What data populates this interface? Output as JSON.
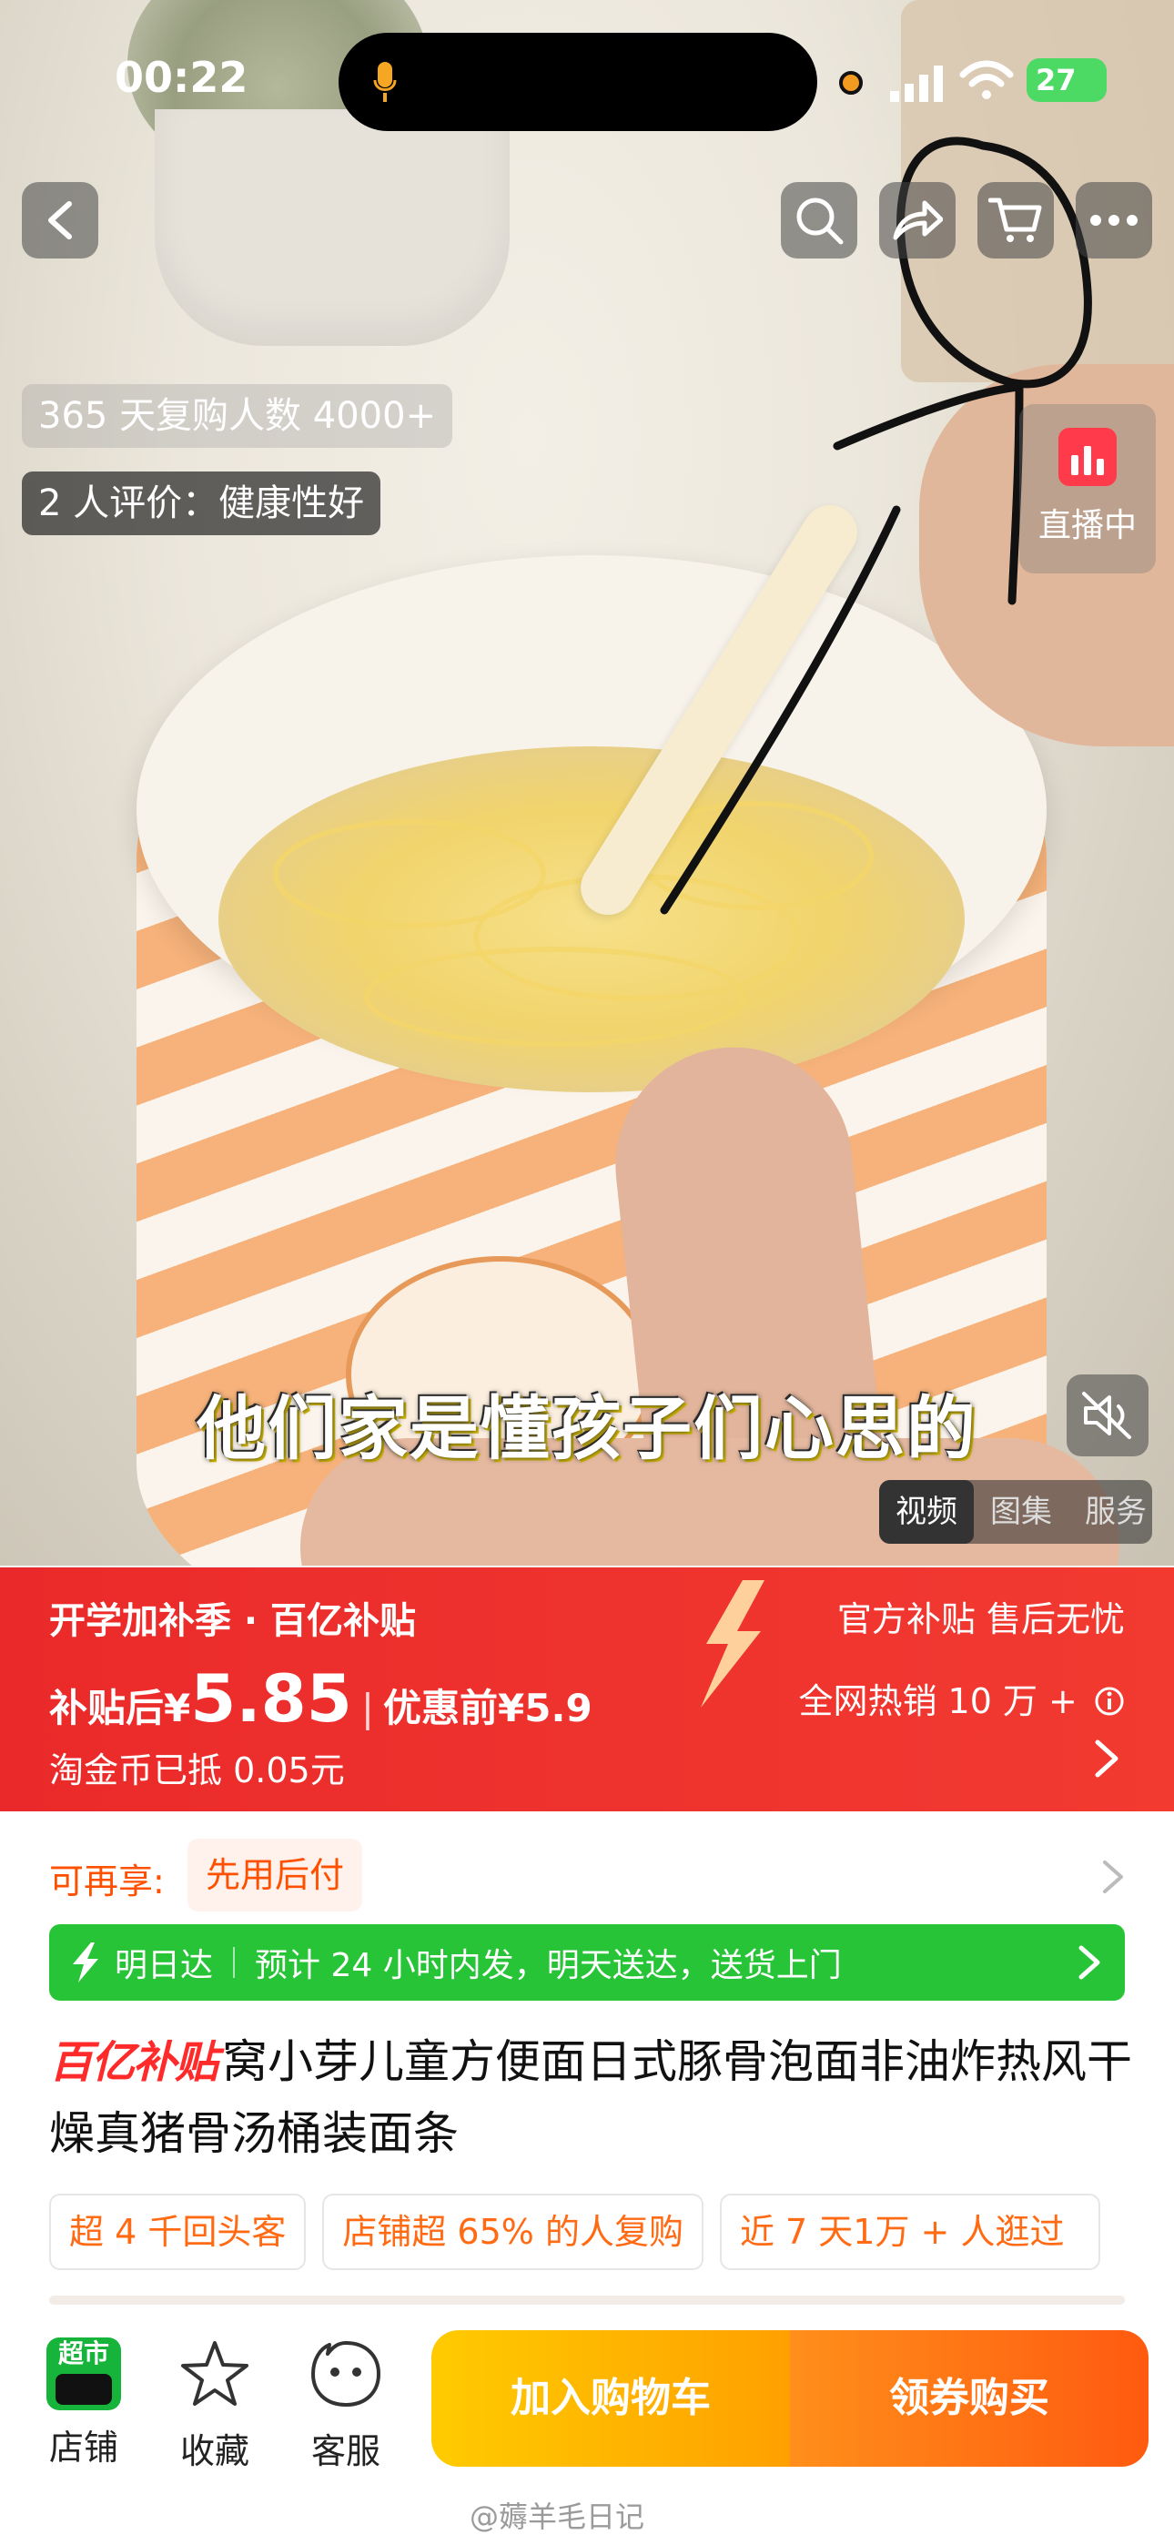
{
  "status_bar": {
    "time": "00:22",
    "battery": "27"
  },
  "hero": {
    "tag_repurchase": "365 天复购人数 4000+",
    "tag_review": "2 人评价：健康性好",
    "live_label": "直播中",
    "subtitle": "他们家是懂孩子们心思的",
    "media_tabs": [
      "视频",
      "图集",
      "服务"
    ]
  },
  "promo": {
    "headline": "开学加补季 · 百亿补贴",
    "perks": "官方补贴 售后无忧",
    "price_prefix": "补贴后¥",
    "price_value": "5.85",
    "price_before": "优惠前¥5.9",
    "sales": "全网热销 10 万 +",
    "coin_note": "淘金币已抵 0.05元"
  },
  "again": {
    "label": "可再享:",
    "chip": "先用后付"
  },
  "delivery": {
    "badge": "明日达",
    "text": "预计 24 小时内发，明天送达，送货上门"
  },
  "product": {
    "badge": "百亿补贴",
    "title": "窝小芽儿童方便面日式豚骨泡面非油炸热风干燥真猪骨汤桶装面条"
  },
  "chips": [
    "超 4 千回头客",
    "店铺超 65% 的人复购",
    "近 7 天1万 + 人逛过"
  ],
  "bottom_bar": {
    "shop_badge": "超市",
    "shop": "店铺",
    "favorite": "收藏",
    "service": "客服",
    "add_to_cart": "加入购物车",
    "buy": "领券购买"
  },
  "watermark": "@薅羊毛日记",
  "colors": {
    "promo_red": "#ea2a2a",
    "delivery_green": "#27c437",
    "accent_orange": "#ff5000",
    "cart_yellow": "#ffb300",
    "buy_orange": "#ff6a10"
  }
}
